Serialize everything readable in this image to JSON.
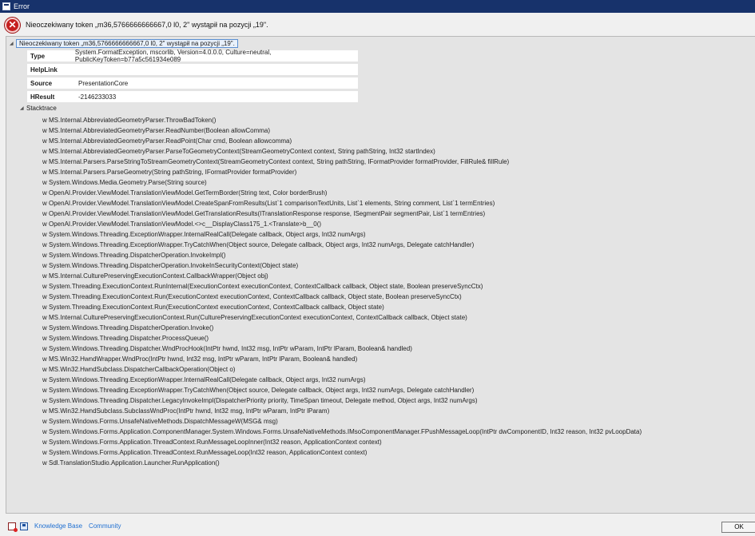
{
  "window": {
    "title": "Error"
  },
  "header": {
    "message": "Nieoczekiwany token „m36,5766666666667,0 l0, 2\" wystąpił na pozycji „19\"."
  },
  "exception": {
    "root_label": "Nieoczekiwany token „m36,5766666666667,0 l0, 2\" wystąpił na pozycji „19\".",
    "properties": [
      {
        "key": "Type",
        "value": "System.FormatException, mscorlib, Version=4.0.0.0, Culture=neutral, PublicKeyToken=b77a5c561934e089"
      },
      {
        "key": "HelpLink",
        "value": ""
      },
      {
        "key": "Source",
        "value": "PresentationCore"
      },
      {
        "key": "HResult",
        "value": "-2146233033"
      }
    ],
    "stacktrace_label": "Stacktrace",
    "stacktrace": [
      "w MS.Internal.AbbreviatedGeometryParser.ThrowBadToken()",
      "w MS.Internal.AbbreviatedGeometryParser.ReadNumber(Boolean allowComma)",
      "w MS.Internal.AbbreviatedGeometryParser.ReadPoint(Char cmd, Boolean allowcomma)",
      "w MS.Internal.AbbreviatedGeometryParser.ParseToGeometryContext(StreamGeometryContext context, String pathString, Int32 startIndex)",
      "w MS.Internal.Parsers.ParseStringToStreamGeometryContext(StreamGeometryContext context, String pathString, IFormatProvider formatProvider, FillRule& fillRule)",
      "w MS.Internal.Parsers.ParseGeometry(String pathString, IFormatProvider formatProvider)",
      "w System.Windows.Media.Geometry.Parse(String source)",
      "w OpenAI.Provider.ViewModel.TranslationViewModel.GetTermBorder(String text, Color borderBrush)",
      "w OpenAI.Provider.ViewModel.TranslationViewModel.CreateSpanFromResults(List`1 comparisonTextUnits, List`1 elements, String comment, List`1 termEntries)",
      "w OpenAI.Provider.ViewModel.TranslationViewModel.GetTranslationResults(ITranslationResponse response, ISegmentPair segmentPair, List`1 termEntries)",
      "w OpenAI.Provider.ViewModel.TranslationViewModel.<>c__DisplayClass175_1.<Translate>b__0()",
      "w System.Windows.Threading.ExceptionWrapper.InternalRealCall(Delegate callback, Object args, Int32 numArgs)",
      "w System.Windows.Threading.ExceptionWrapper.TryCatchWhen(Object source, Delegate callback, Object args, Int32 numArgs, Delegate catchHandler)",
      "w System.Windows.Threading.DispatcherOperation.InvokeImpl()",
      "w System.Windows.Threading.DispatcherOperation.InvokeInSecurityContext(Object state)",
      "w MS.Internal.CulturePreservingExecutionContext.CallbackWrapper(Object obj)",
      "w System.Threading.ExecutionContext.RunInternal(ExecutionContext executionContext, ContextCallback callback, Object state, Boolean preserveSyncCtx)",
      "w System.Threading.ExecutionContext.Run(ExecutionContext executionContext, ContextCallback callback, Object state, Boolean preserveSyncCtx)",
      "w System.Threading.ExecutionContext.Run(ExecutionContext executionContext, ContextCallback callback, Object state)",
      "w MS.Internal.CulturePreservingExecutionContext.Run(CulturePreservingExecutionContext executionContext, ContextCallback callback, Object state)",
      "w System.Windows.Threading.DispatcherOperation.Invoke()",
      "w System.Windows.Threading.Dispatcher.ProcessQueue()",
      "w System.Windows.Threading.Dispatcher.WndProcHook(IntPtr hwnd, Int32 msg, IntPtr wParam, IntPtr lParam, Boolean& handled)",
      "w MS.Win32.HwndWrapper.WndProc(IntPtr hwnd, Int32 msg, IntPtr wParam, IntPtr lParam, Boolean& handled)",
      "w MS.Win32.HwndSubclass.DispatcherCallbackOperation(Object o)",
      "w System.Windows.Threading.ExceptionWrapper.InternalRealCall(Delegate callback, Object args, Int32 numArgs)",
      "w System.Windows.Threading.ExceptionWrapper.TryCatchWhen(Object source, Delegate callback, Object args, Int32 numArgs, Delegate catchHandler)",
      "w System.Windows.Threading.Dispatcher.LegacyInvokeImpl(DispatcherPriority priority, TimeSpan timeout, Delegate method, Object args, Int32 numArgs)",
      "w MS.Win32.HwndSubclass.SubclassWndProc(IntPtr hwnd, Int32 msg, IntPtr wParam, IntPtr lParam)",
      "w System.Windows.Forms.UnsafeNativeMethods.DispatchMessageW(MSG& msg)",
      "w System.Windows.Forms.Application.ComponentManager.System.Windows.Forms.UnsafeNativeMethods.IMsoComponentManager.FPushMessageLoop(IntPtr dwComponentID, Int32 reason, Int32 pvLoopData)",
      "w System.Windows.Forms.Application.ThreadContext.RunMessageLoopInner(Int32 reason, ApplicationContext context)",
      "w System.Windows.Forms.Application.ThreadContext.RunMessageLoop(Int32 reason, ApplicationContext context)",
      "w Sdl.TranslationStudio.Application.Launcher.RunApplication()"
    ]
  },
  "footer": {
    "icons": [
      "error-report-icon",
      "save-icon"
    ],
    "links": [
      "Knowledge Base",
      "Community"
    ],
    "ok_label": "OK"
  },
  "colors": {
    "titlebar": "#17326b",
    "link": "#1f6fd1",
    "error": "#c51f1f"
  }
}
